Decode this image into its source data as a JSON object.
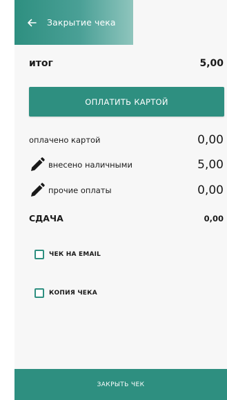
{
  "header": {
    "title": "Закрытие чека",
    "back_icon": "arrow-left-icon"
  },
  "total": {
    "label": "итог",
    "value": "5,00"
  },
  "pay_card_button": {
    "label": "ОПЛАТИТЬ КАРТОЙ"
  },
  "payments": [
    {
      "label": "оплачено картой",
      "value": "0,00",
      "editable": false
    },
    {
      "label": "внесено наличными",
      "value": "5,00",
      "editable": true,
      "icon": "pencil-icon"
    },
    {
      "label": "прочие оплаты",
      "value": "0,00",
      "editable": true,
      "icon": "pencil-icon"
    }
  ],
  "change": {
    "label": "СДАЧА",
    "value": "0,00"
  },
  "options": [
    {
      "label": "ЧЕК НА EMAIL",
      "checked": false
    },
    {
      "label": "КОПИЯ ЧЕКА",
      "checked": false
    }
  ],
  "close_button": {
    "label": "ЗАКРЫТЬ ЧЕК"
  },
  "colors": {
    "accent": "#2e8f80",
    "text": "#1a1a1a",
    "panel": "#f7f7f7"
  }
}
